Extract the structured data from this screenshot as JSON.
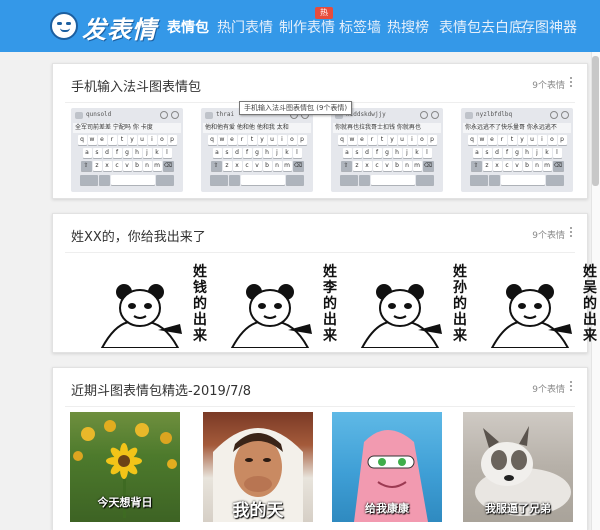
{
  "header": {
    "logo_text": "发表情",
    "nav": [
      {
        "label": "表情包",
        "active": true
      },
      {
        "label": "热门表情",
        "active": false
      },
      {
        "label": "制作表情",
        "active": false
      },
      {
        "label": "标签墙",
        "active": false
      },
      {
        "label": "热搜榜",
        "active": false
      },
      {
        "label": "表情包去白底",
        "active": false
      },
      {
        "label": "存图神器",
        "active": false
      }
    ],
    "hot_badge": "热"
  },
  "sections": [
    {
      "title": "手机输入法斗图表情包",
      "count": "9个表情",
      "tooltip": "手机输入法斗图表情包 (9个表情)",
      "keyboards": [
        {
          "typed": "qunsold",
          "candidates": "全军司前差差  宁配吗  你  卡度"
        },
        {
          "typed": "thrai",
          "candidates": "他和他有爱  他和他  他和我  太和"
        },
        {
          "typed": "niddskdwjjy",
          "candidates": "你就再也拉我哥士扣钱  你就再也"
        },
        {
          "typed": "nyzlbfdlbq",
          "candidates": "你永远逃不了快乐量哥  你永远逃不"
        }
      ],
      "rows": [
        [
          "q",
          "w",
          "e",
          "r",
          "t",
          "y",
          "u",
          "i",
          "o",
          "p"
        ],
        [
          "a",
          "s",
          "d",
          "f",
          "g",
          "h",
          "j",
          "k",
          "l"
        ],
        [
          "z",
          "x",
          "c",
          "v",
          "b",
          "n",
          "m"
        ]
      ]
    },
    {
      "title": "姓XX的，你给我出来了",
      "count": "9个表情",
      "panels": [
        "姓钱的出来",
        "姓李的出来",
        "姓孙的出来",
        "姓吴的出来"
      ]
    },
    {
      "title": "近期斗图表情包精选-2019/7/8",
      "count": "9个表情",
      "photos": [
        {
          "caption": "今天想背日"
        },
        {
          "caption": "我的天"
        },
        {
          "caption": "给我康康"
        },
        {
          "caption": "我服逼了兄弟"
        }
      ]
    }
  ],
  "colors": {
    "header_bg": "#3498e8",
    "page_bg": "#f1f1f1",
    "badge": "#e74c3c"
  },
  "icons": {
    "logo": "face-icon",
    "more": "more-vertical-icon"
  }
}
